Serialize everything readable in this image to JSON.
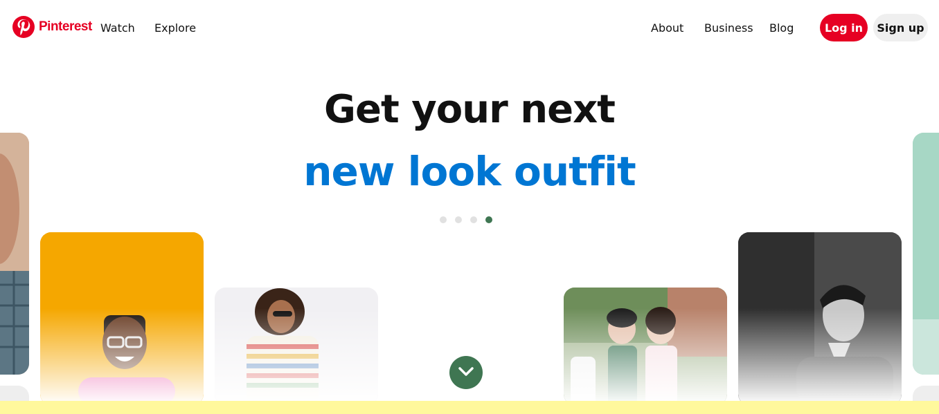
{
  "header": {
    "brand": "Pinterest",
    "nav_left": [
      "Watch",
      "Explore"
    ],
    "nav_right": [
      "About",
      "Business",
      "Blog"
    ],
    "login_label": "Log in",
    "signup_label": "Sign up"
  },
  "hero": {
    "line1": "Get your next",
    "line2": "new look outfit",
    "carousel_active_index": 4,
    "carousel_count": 4
  },
  "colors": {
    "brand": "#e60023",
    "accent_text": "#0076d3",
    "active_dot": "#3f7652",
    "bottom_bar": "#fff89c"
  },
  "icons": {
    "logo": "pinterest-logo-icon",
    "scroll": "chevron-down-icon"
  }
}
